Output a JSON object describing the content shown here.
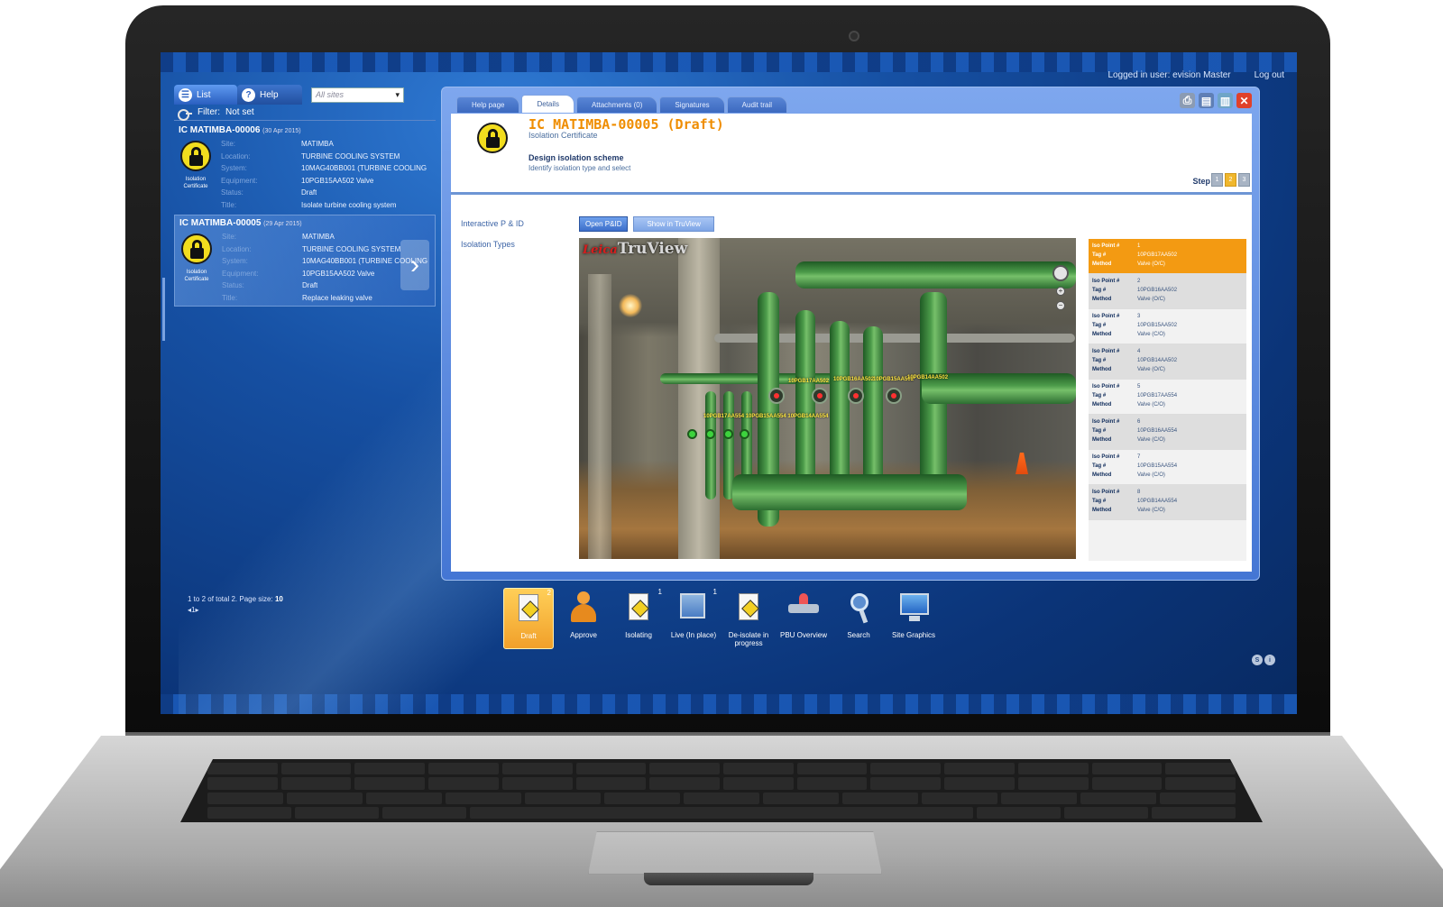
{
  "topbar": {
    "logged_in": "Logged in user: evision Master",
    "logout": "Log out"
  },
  "left": {
    "tabs": [
      {
        "label": "List"
      },
      {
        "label": "Help"
      }
    ],
    "site_select": "All sites",
    "filter_label": "Filter:",
    "filter_value": "Not set",
    "certs": [
      {
        "id": "IC MATIMBA-00006",
        "date": "(30 Apr 2015)",
        "caption_line1": "Isolation",
        "caption_line2": "Certificate",
        "fields": [
          {
            "label": "Site:",
            "value": "MATIMBA"
          },
          {
            "label": "Location:",
            "value": "TURBINE COOLING SYSTEM"
          },
          {
            "label": "System:",
            "value": "10MAG40BB001 (TURBINE COOLING"
          },
          {
            "label": "Equipment:",
            "value": "10PGB15AA502 Valve"
          },
          {
            "label": "Status:",
            "value": "Draft"
          },
          {
            "label": "Title:",
            "value": "Isolate turbine cooling system"
          }
        ]
      },
      {
        "id": "IC MATIMBA-00005",
        "date": "(29 Apr 2015)",
        "caption_line1": "Isolation",
        "caption_line2": "Certificate",
        "fields": [
          {
            "label": "Site:",
            "value": "MATIMBA"
          },
          {
            "label": "Location:",
            "value": "TURBINE COOLING SYSTEM"
          },
          {
            "label": "System:",
            "value": "10MAG40BB001 (TURBINE COOLING"
          },
          {
            "label": "Equipment:",
            "value": "10PGB15AA502 Valve"
          },
          {
            "label": "Status:",
            "value": "Draft"
          },
          {
            "label": "Title:",
            "value": "Replace leaking valve"
          }
        ]
      }
    ],
    "page_info": "1 to 2 of total 2. Page size:",
    "page_size": "10",
    "page_nav": "◂1▸"
  },
  "detail": {
    "tabs": [
      {
        "label": "Help page"
      },
      {
        "label": "Details"
      },
      {
        "label": "Attachments (0)"
      },
      {
        "label": "Signatures"
      },
      {
        "label": "Audit trail"
      }
    ],
    "title": "IC MATIMBA-00005 (Draft)",
    "subtitle": "Isolation Certificate",
    "step_title": "Design isolation scheme",
    "step_sub": "Identify isolation type and select",
    "step_label": "Step",
    "step_buttons": [
      "1",
      "2",
      "3"
    ],
    "current_step": 2,
    "interactive_label": "Interactive P & ID",
    "types_label": "Isolation Types",
    "btn_open_pid": "Open P&ID",
    "btn_truview": "Show in TruView",
    "viewer": {
      "logo_brand": "Leica",
      "logo_name": "TruView",
      "tags_top": [
        "10PGB17AA502",
        "10PGB16AA502",
        "10PGB15AA502",
        "10PGB14AA502"
      ],
      "tag_bottom": "10PGB17AA554 10PGB15AA554 10PGB14AA554"
    },
    "iso_labels": {
      "point": "Iso Point #",
      "tag": "Tag #",
      "method": "Method"
    },
    "iso_points": [
      {
        "num": "1",
        "tag": "10PGB17AA502",
        "method": "Valve (O/C)"
      },
      {
        "num": "2",
        "tag": "10PGB16AA502",
        "method": "Valve (O/C)"
      },
      {
        "num": "3",
        "tag": "10PGB15AA502",
        "method": "Valve (C/O)"
      },
      {
        "num": "4",
        "tag": "10PGB14AA502",
        "method": "Valve (O/C)"
      },
      {
        "num": "5",
        "tag": "10PGB17AA554",
        "method": "Valve (C/O)"
      },
      {
        "num": "6",
        "tag": "10PGB16AA554",
        "method": "Valve (C/O)"
      },
      {
        "num": "7",
        "tag": "10PGB15AA554",
        "method": "Valve (C/O)"
      },
      {
        "num": "8",
        "tag": "10PGB14AA554",
        "method": "Valve (C/O)"
      }
    ]
  },
  "dock": [
    {
      "label": "Draft",
      "badge": "2"
    },
    {
      "label": "Approve",
      "badge": ""
    },
    {
      "label": "Isolating",
      "badge": "1"
    },
    {
      "label": "Live (In place)",
      "badge": "1"
    },
    {
      "label": "De-isolate in progress",
      "badge": ""
    },
    {
      "label": "PBU Overview",
      "badge": ""
    },
    {
      "label": "Search",
      "badge": ""
    },
    {
      "label": "Site Graphics",
      "badge": ""
    }
  ],
  "status_icons": [
    "S",
    "i"
  ],
  "colors": {
    "accent": "#ef8d00",
    "selected_iso": "#f39a12",
    "screen_bg": "#1650a3"
  }
}
